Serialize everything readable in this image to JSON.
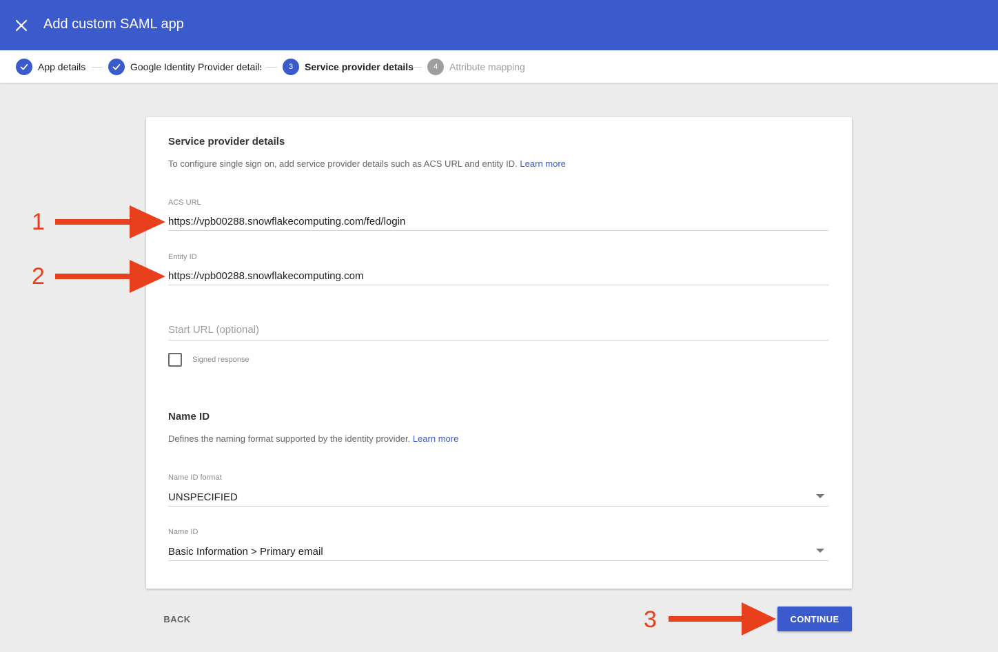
{
  "header": {
    "title": "Add custom SAML app",
    "close_icon": "close-icon"
  },
  "stepper": {
    "steps": [
      {
        "number": "1",
        "label": "App details",
        "state": "done"
      },
      {
        "number": "2",
        "label": "Google Identity Provider details",
        "state": "done"
      },
      {
        "number": "3",
        "label": "Service provider details",
        "state": "active"
      },
      {
        "number": "4",
        "label": "Attribute mapping",
        "state": "todo"
      }
    ]
  },
  "service_provider": {
    "title": "Service provider details",
    "description": "To configure single sign on, add service provider details such as ACS URL and entity ID.",
    "learn_more": "Learn more",
    "acs_url": {
      "label": "ACS URL",
      "value": "https://vpb00288.snowflakecomputing.com/fed/login"
    },
    "entity_id": {
      "label": "Entity ID",
      "value": "https://vpb00288.snowflakecomputing.com"
    },
    "start_url": {
      "placeholder": "Start URL (optional)",
      "value": ""
    },
    "signed_response": {
      "label": "Signed response",
      "checked": false
    }
  },
  "name_id_section": {
    "title": "Name ID",
    "description": "Defines the naming format supported by the identity provider.",
    "learn_more": "Learn more",
    "name_id_format": {
      "label": "Name ID format",
      "value": "UNSPECIFIED"
    },
    "name_id": {
      "label": "Name ID",
      "value": "Basic Information > Primary email"
    }
  },
  "footer": {
    "back_label": "BACK",
    "continue_label": "CONTINUE"
  },
  "annotations": {
    "markers": [
      "1",
      "2",
      "3"
    ],
    "color": "#e8401c"
  },
  "colors": {
    "accent": "#3b5bcc",
    "inactive_step": "#9e9e9e",
    "background": "#ececec"
  }
}
